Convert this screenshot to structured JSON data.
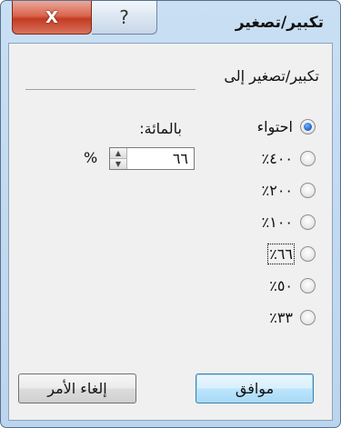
{
  "window": {
    "title": "تكبير/تصغير",
    "close_glyph": "X",
    "help_glyph": "?"
  },
  "group": {
    "label": "تكبير/تصغير إلى"
  },
  "options": [
    {
      "label": "احتواء",
      "checked": true
    },
    {
      "label": "٤٠٠٪",
      "checked": false
    },
    {
      "label": "٢٠٠٪",
      "checked": false
    },
    {
      "label": "١٠٠٪",
      "checked": false
    },
    {
      "label": "٦٦٪",
      "checked": false
    },
    {
      "label": "٥٠٪",
      "checked": false
    },
    {
      "label": "٣٣٪",
      "checked": false
    }
  ],
  "percent": {
    "label": "بالمائة:",
    "value": "٦٦",
    "sign": "%"
  },
  "buttons": {
    "ok": "موافق",
    "cancel": "إلغاء الأمر"
  }
}
